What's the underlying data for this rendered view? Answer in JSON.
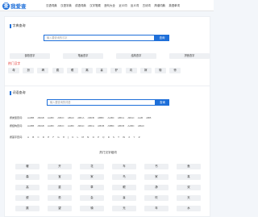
{
  "header": {
    "logo_mark": "查",
    "logo_text": "我爱查",
    "nav": [
      "汉语词典",
      "汉语字典",
      "成语词典",
      "汉字笔顺",
      "造句大全",
      "近义词",
      "反义词",
      "古诗词",
      "简谱词典",
      "英语单词"
    ]
  },
  "char_search": {
    "title": "字典查询",
    "placeholder": "输入要查询的汉字",
    "button": "查询",
    "buttons": [
      "部首查字",
      "笔画查字",
      "结构查字",
      "拼音查字"
    ],
    "hot_title": "热门汉字",
    "hot_chars": [
      "母",
      "扮",
      "碑",
      "跳",
      "眼",
      "离",
      "喜",
      "驴",
      "向",
      "嫁",
      "葡",
      "惊"
    ]
  },
  "idiom_search": {
    "title": "词语查询",
    "placeholder": "输入要查询的词语",
    "button": "查询",
    "rows": [
      {
        "label": "按类型查词:",
        "items": [
          "AABB",
          "ABAB",
          "AABC",
          "ABCC",
          "ABAC",
          "ABCA",
          "ABCB",
          "ABBC",
          "AABC",
          "ABCA",
          "ABAC",
          "AAB",
          "ABB"
        ]
      },
      {
        "label": "按结构查词:",
        "items": [
          "AABB",
          "ABAB",
          "AABC",
          "ABCC",
          "AABC",
          "ABAC",
          "ABCA",
          "ABCB",
          "ABBC",
          "ABCB",
          "AABC",
          "ABAC"
        ]
      },
      {
        "label": "按首字查词:",
        "items": [
          "A",
          "B",
          "C",
          "D",
          "E",
          "F",
          "G",
          "H",
          "J",
          "K",
          "L",
          "M",
          "N",
          "O",
          "P",
          "Q",
          "R",
          "S",
          "T",
          "W",
          "X",
          "Y",
          "Z"
        ]
      }
    ],
    "hot_title": "热门汉字组词",
    "grid": [
      "暖",
      "开",
      "花",
      "车",
      "书",
      "鱼",
      "森",
      "宝",
      "家",
      "鸟",
      "家",
      "真",
      "高",
      "重",
      "草",
      "眼",
      "静",
      "双",
      "蜕",
      "恐",
      "会",
      "喜",
      "吹",
      "天",
      "跳",
      "望",
      "骑",
      "光",
      "年",
      "水"
    ]
  }
}
